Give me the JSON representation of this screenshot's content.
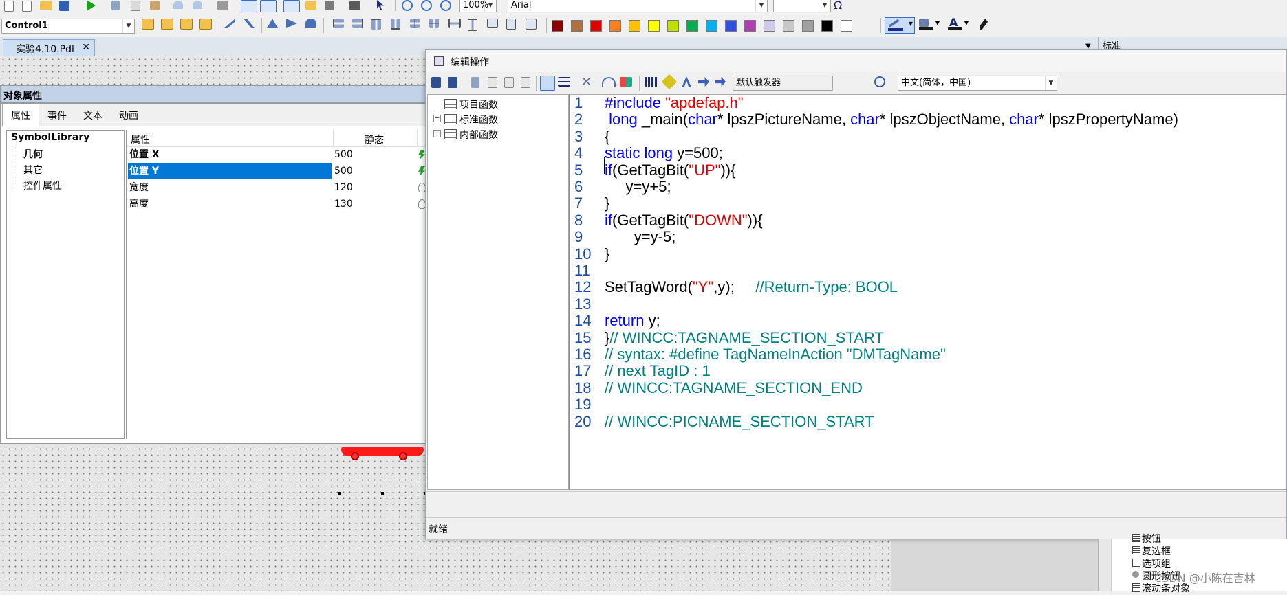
{
  "toolbar1": {
    "zoom": "100%",
    "font": "Arial",
    "omega": "Ω"
  },
  "toolbar2": {
    "object_combo": "Control1"
  },
  "doc_tab": {
    "title": "实验4.10.Pdl",
    "close": "✕"
  },
  "right_panel_header": "标准",
  "object_properties": {
    "title": "对象属性",
    "tabs": [
      "属性",
      "事件",
      "文本",
      "动画"
    ],
    "tree": {
      "root": "SymbolLibrary",
      "items": [
        "几何",
        "其它",
        "控件属性"
      ]
    },
    "table": {
      "col_property": "属性",
      "col_static": "静态",
      "rows": [
        {
          "name": "位置 X",
          "value": "500"
        },
        {
          "name": "位置 Y",
          "value": "500"
        },
        {
          "name": "宽度",
          "value": "120"
        },
        {
          "name": "高度",
          "value": "130"
        }
      ]
    }
  },
  "edit_action": {
    "title": "编辑操作",
    "trigger_combo": "默认触发器",
    "language_combo": "中文(简体，中国)",
    "func_tree": [
      "项目函数",
      "标准函数",
      "内部函数"
    ],
    "status": "就绪",
    "code": [
      {
        "n": "1",
        "t": [
          {
            "c": "kw",
            "s": "#include "
          },
          {
            "c": "str",
            "s": "\"apdefap.h\""
          }
        ]
      },
      {
        "n": "2",
        "t": [
          {
            "c": "kw",
            "s": " long"
          },
          {
            "c": "",
            "s": " _main("
          },
          {
            "c": "kw",
            "s": "char"
          },
          {
            "c": "",
            "s": "* lpszPictureName, "
          },
          {
            "c": "kw",
            "s": "char"
          },
          {
            "c": "",
            "s": "* lpszObjectName, "
          },
          {
            "c": "kw",
            "s": "char"
          },
          {
            "c": "",
            "s": "* lpszPropertyName)"
          }
        ]
      },
      {
        "n": "3",
        "t": [
          {
            "c": "",
            "s": "{"
          }
        ]
      },
      {
        "n": "4",
        "t": [
          {
            "c": "kw",
            "s": "static long"
          },
          {
            "c": "",
            "s": " y=500;"
          }
        ]
      },
      {
        "n": "5",
        "t": [
          {
            "c": "kw",
            "s": "if"
          },
          {
            "c": "",
            "s": "(GetTagBit("
          },
          {
            "c": "str",
            "s": "\"UP\""
          },
          {
            "c": "",
            "s": ")){"
          }
        ]
      },
      {
        "n": "6",
        "t": [
          {
            "c": "",
            "s": "     y=y+5;"
          }
        ]
      },
      {
        "n": "7",
        "t": [
          {
            "c": "",
            "s": "}"
          }
        ]
      },
      {
        "n": "8",
        "t": [
          {
            "c": "kw",
            "s": "if"
          },
          {
            "c": "",
            "s": "(GetTagBit("
          },
          {
            "c": "str",
            "s": "\"DOWN\""
          },
          {
            "c": "",
            "s": ")){"
          }
        ]
      },
      {
        "n": "9",
        "t": [
          {
            "c": "",
            "s": "       y=y-5;"
          }
        ]
      },
      {
        "n": "10",
        "t": [
          {
            "c": "",
            "s": "}"
          }
        ]
      },
      {
        "n": "11",
        "t": [
          {
            "c": "",
            "s": ""
          }
        ]
      },
      {
        "n": "12",
        "t": [
          {
            "c": "",
            "s": "SetTagWord("
          },
          {
            "c": "str",
            "s": "\"Y\""
          },
          {
            "c": "",
            "s": ",y);     "
          },
          {
            "c": "cm",
            "s": "//Return-Type: BOOL"
          }
        ]
      },
      {
        "n": "13",
        "t": [
          {
            "c": "",
            "s": ""
          }
        ]
      },
      {
        "n": "14",
        "t": [
          {
            "c": "kw",
            "s": "return"
          },
          {
            "c": "",
            "s": " y;"
          }
        ]
      },
      {
        "n": "15",
        "t": [
          {
            "c": "",
            "s": "}"
          },
          {
            "c": "cm",
            "s": "// WINCC:TAGNAME_SECTION_START"
          }
        ]
      },
      {
        "n": "16",
        "t": [
          {
            "c": "cm",
            "s": "// syntax: #define TagNameInAction \"DMTagName\""
          }
        ]
      },
      {
        "n": "17",
        "t": [
          {
            "c": "cm",
            "s": "// next TagID : 1"
          }
        ]
      },
      {
        "n": "18",
        "t": [
          {
            "c": "cm",
            "s": "// WINCC:TAGNAME_SECTION_END"
          }
        ]
      },
      {
        "n": "19",
        "t": [
          {
            "c": "",
            "s": ""
          }
        ]
      },
      {
        "n": "20",
        "t": [
          {
            "c": "cm",
            "s": "// WINCC:PICNAME_SECTION_START"
          }
        ]
      }
    ]
  },
  "object_palette": [
    "按钮",
    "复选框",
    "选项组",
    "圆形按钮",
    "滚动条对象"
  ],
  "watermark": "CSDN @小陈在吉林",
  "colors": {
    "selection": "#0078d7",
    "keyword": "#0000ff",
    "string": "#e00000",
    "comment": "#008080",
    "line_number": "#1f4e9c",
    "car": "#ff1a1a"
  },
  "palette_colors": [
    "#8b0000",
    "#b07040",
    "#e00000",
    "#ff7f20",
    "#ffc000",
    "#ffff00",
    "#c0e000",
    "#00b050",
    "#00b0f0",
    "#3050e0",
    "#b040b0",
    "#d0c8e8",
    "#c8c8c8",
    "#a0a0a0",
    "#000000",
    "#ffffff"
  ]
}
